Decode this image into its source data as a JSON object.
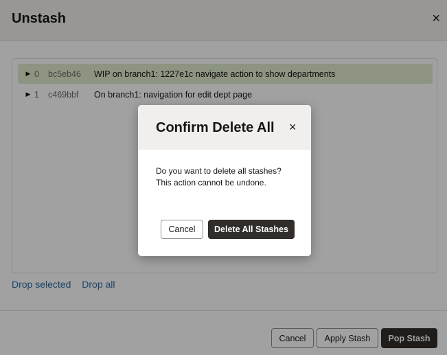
{
  "dialog": {
    "title": "Unstash",
    "close_icon": "×"
  },
  "stashes": [
    {
      "index": "0",
      "hash": "bc5eb46",
      "message": "WIP on branch1: 1227e1c navigate action to show departments",
      "selected": true
    },
    {
      "index": "1",
      "hash": "c469bbf",
      "message": "On branch1: navigation for edit dept page",
      "selected": false
    }
  ],
  "links": {
    "drop_selected": "Drop selected",
    "drop_all": "Drop all"
  },
  "footer": {
    "cancel": "Cancel",
    "apply": "Apply Stash",
    "pop": "Pop Stash"
  },
  "confirm": {
    "title": "Confirm Delete All",
    "close_icon": "×",
    "line1": "Do you want to delete all stashes?",
    "line2": "This action cannot be undone.",
    "cancel": "Cancel",
    "delete": "Delete All Stashes"
  }
}
